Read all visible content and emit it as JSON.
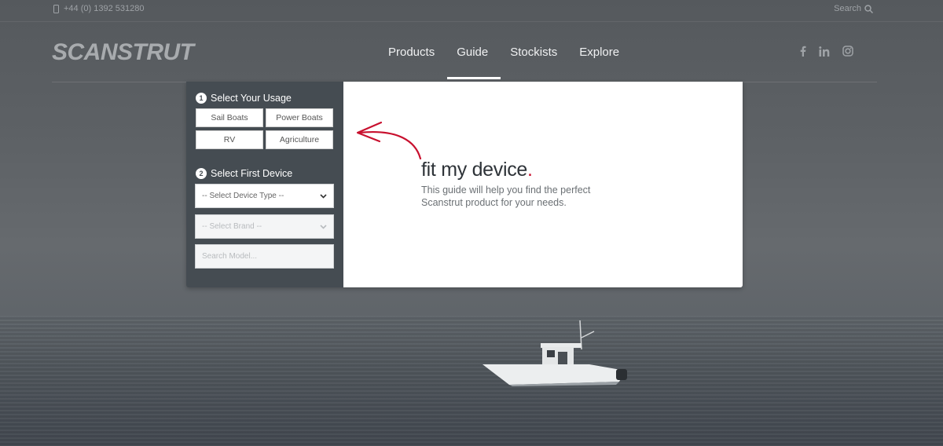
{
  "topbar": {
    "phone": "+44 (0) 1392 531280",
    "search_label": "Search"
  },
  "header": {
    "logo": "SCANSTRUT",
    "nav": [
      "Products",
      "Guide",
      "Stockists",
      "Explore"
    ],
    "active_nav": "Guide",
    "social": [
      "facebook-icon",
      "linkedin-icon",
      "instagram-icon"
    ]
  },
  "guide": {
    "step1": {
      "number": "1",
      "title": "Select Your Usage"
    },
    "usage_options": [
      "Sail Boats",
      "Power Boats",
      "RV",
      "Agriculture"
    ],
    "step2": {
      "number": "2",
      "title": "Select First Device"
    },
    "device_type_select": "-- Select Device Type --",
    "brand_select": "-- Select Brand --",
    "model_search_placeholder": "Search Model...",
    "heading": "fit my device",
    "heading_dot": ".",
    "description": "This guide will help you find the perfect Scanstrut product for your needs.",
    "accent_color": "#c8102e"
  }
}
